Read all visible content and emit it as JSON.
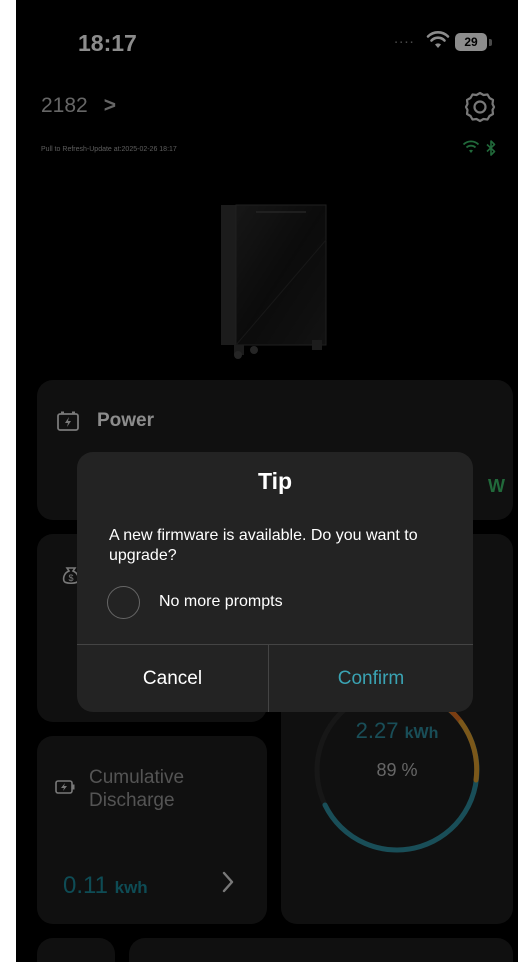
{
  "status_bar": {
    "time": "18:17",
    "signal": "....",
    "battery": "29"
  },
  "header": {
    "device_id": "2182",
    "chevron": ">",
    "refresh_text": "Pull to Refresh-Update at:2025-02-26 18:17"
  },
  "cards": {
    "power": {
      "title": "Power",
      "unit_partial": "W"
    },
    "energy": {
      "value": "2.27",
      "unit": "kWh",
      "percent": "89 %",
      "percent_value": 89,
      "ring_colors": [
        "#2f8fa0",
        "#e0a030",
        "#e07020"
      ]
    },
    "discharge": {
      "label": "Cumulative Discharge",
      "value": "0.11",
      "unit": "kwh"
    }
  },
  "dialog": {
    "title": "Tip",
    "message": "A new firmware is available. Do you want to upgrade?",
    "checkbox_label": "No more prompts",
    "cancel_label": "Cancel",
    "confirm_label": "Confirm"
  },
  "icons": {
    "settings": "gear-icon",
    "wifi": "wifi-icon",
    "bluetooth": "bluetooth-icon",
    "power": "battery-charge-icon",
    "money": "money-bag-icon",
    "discharge": "battery-discharge-icon",
    "chevron": "chevron-right-icon"
  },
  "colors": {
    "accent": "#3aa3b3",
    "green": "#3dbf6b",
    "background": "#000000",
    "card": "#1e1e1e"
  }
}
